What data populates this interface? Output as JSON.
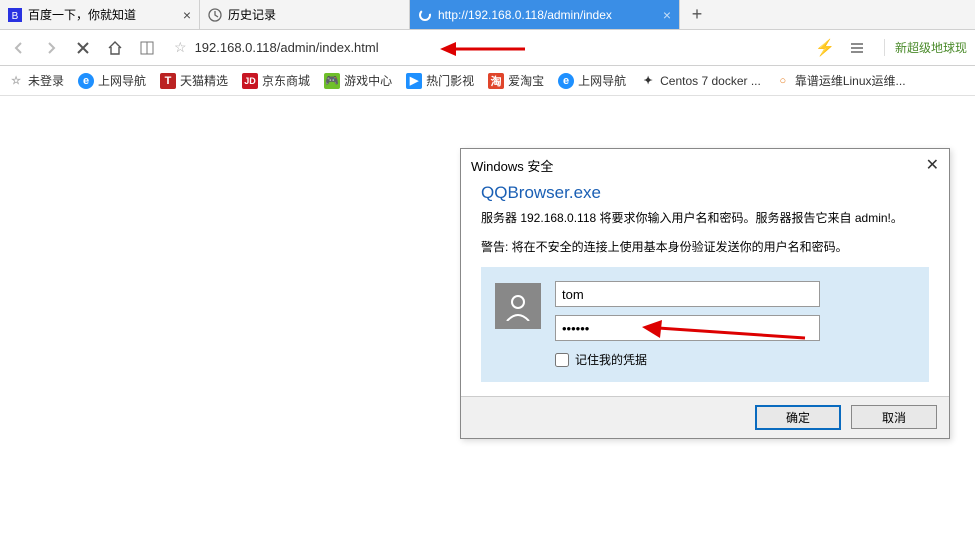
{
  "tabs": [
    {
      "label": "百度一下，你就知道",
      "favicon": "baidu"
    },
    {
      "label": "历史记录",
      "favicon": "history"
    },
    {
      "label": "http://192.168.0.118/admin/index",
      "favicon": "loading",
      "active": true
    }
  ],
  "address_bar": {
    "url": "192.168.0.118/admin/index.html"
  },
  "right_tool": "新超级地球现",
  "bookmarks": [
    {
      "label": "未登录",
      "icon_bg": "#ccc",
      "icon_text": ""
    },
    {
      "label": "上网导航",
      "icon_bg": "#e86c3a",
      "icon_text": "€"
    },
    {
      "label": "天猫精选",
      "icon_bg": "#b22",
      "icon_text": "T"
    },
    {
      "label": "京东商城",
      "icon_bg": "#c81623",
      "icon_text": "JD"
    },
    {
      "label": "游戏中心",
      "icon_bg": "#6fbf2a",
      "icon_text": "🎮"
    },
    {
      "label": "热门影视",
      "icon_bg": "#1e90ff",
      "icon_text": "▶"
    },
    {
      "label": "爱淘宝",
      "icon_bg": "#e0452b",
      "icon_text": "淘"
    },
    {
      "label": "上网导航",
      "icon_bg": "#e86c3a",
      "icon_text": "€"
    },
    {
      "label": "Centos 7 docker ...",
      "icon_bg": "#fff",
      "icon_text": "✦"
    },
    {
      "label": "靠谱运维Linux运维...",
      "icon_bg": "#fff",
      "icon_text": "○"
    }
  ],
  "dialog": {
    "title": "Windows 安全",
    "app": "QQBrowser.exe",
    "message1": "服务器 192.168.0.118 将要求你输入用户名和密码。服务器报告它来自 admin!。",
    "message2": "警告: 将在不安全的连接上使用基本身份验证发送你的用户名和密码。",
    "username": "tom",
    "password": "••••••",
    "remember": "记住我的凭据",
    "ok": "确定",
    "cancel": "取消"
  }
}
